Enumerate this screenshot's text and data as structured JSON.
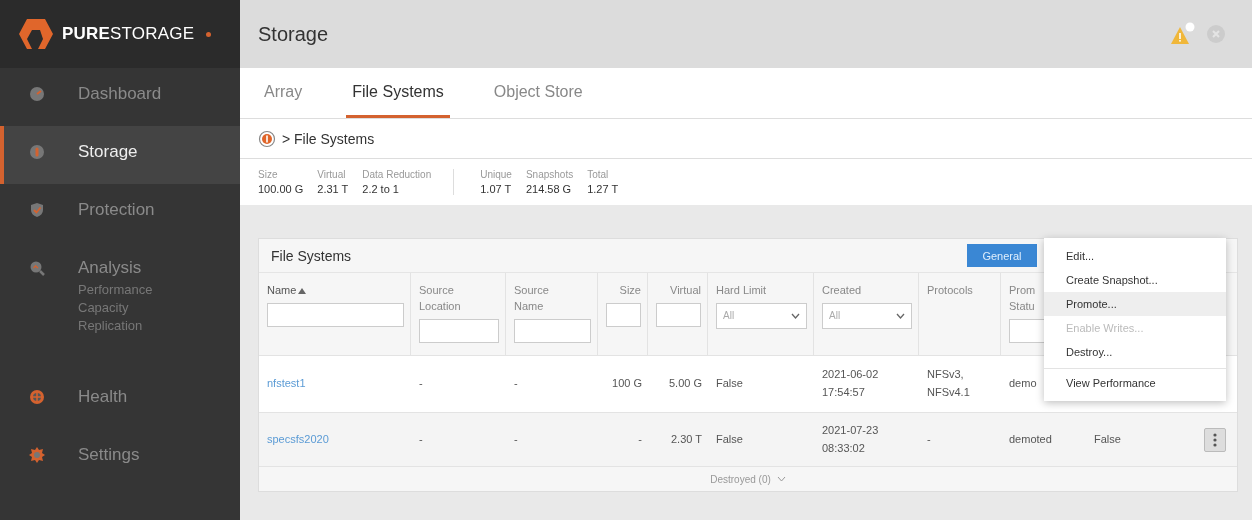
{
  "sidebar": {
    "logo": "**PURE**STORAGE",
    "items": [
      {
        "label": "Dashboard",
        "selected": false
      },
      {
        "label": "Storage",
        "selected": true
      },
      {
        "label": "Protection",
        "selected": false
      },
      {
        "label": "Analysis",
        "selected": false,
        "children": [
          {
            "label": "Performance"
          },
          {
            "label": "Capacity"
          },
          {
            "label": "Replication"
          }
        ]
      },
      {
        "label": "Health",
        "selected": false
      },
      {
        "label": "Settings",
        "selected": false
      }
    ]
  },
  "header": {
    "title": "Storage"
  },
  "tabs": [
    {
      "label": "Array",
      "selected": false
    },
    {
      "label": "File Systems",
      "selected": true
    },
    {
      "label": "Object Store",
      "selected": false
    }
  ],
  "breadcrumb": "> File Systems",
  "stats": [
    [
      {
        "label": "Size",
        "value": "100.00 G"
      },
      {
        "label": "Virtual",
        "value": "2.31 T"
      },
      {
        "label": "Data Reduction",
        "value": "2.2 to 1"
      }
    ],
    [
      {
        "label": "Unique",
        "value": "1.07 T"
      },
      {
        "label": "Snapshots",
        "value": "214.58 G"
      },
      {
        "label": "Total",
        "value": "1.27 T"
      }
    ]
  ],
  "table": {
    "title": "File Systems",
    "view_button": "General",
    "columns": [
      {
        "label": "Name",
        "kind": "text",
        "sorted": true
      },
      {
        "label": "Source Location",
        "kind": "text",
        "sorted": false
      },
      {
        "label": "Source Name",
        "kind": "text",
        "sorted": false
      },
      {
        "label": "Size",
        "kind": "text",
        "sorted": false
      },
      {
        "label": "Virtual",
        "kind": "text",
        "sorted": false
      },
      {
        "label": "Hard Limit",
        "kind": "select",
        "value": "All",
        "sorted": false
      },
      {
        "label": "Created",
        "kind": "select",
        "value": "All",
        "sorted": false
      },
      {
        "label": "Protocols",
        "kind": "plain",
        "sorted": false
      },
      {
        "label": "Prom Statu",
        "kind": "text",
        "sorted": false
      }
    ],
    "rows": [
      {
        "cells": [
          "nfstest1",
          "-",
          "-",
          "100 G",
          "5.00 G",
          "False",
          "2021-06-02 17:54:57",
          "NFSv3, NFSv4.1",
          "demo"
        ]
      },
      {
        "cells": [
          "specsfs2020",
          "-",
          "-",
          "-",
          "2.30 T",
          "False",
          "2021-07-23 08:33:02",
          "-",
          "demoted",
          "False"
        ]
      }
    ],
    "footer": "Destroyed (0)"
  },
  "menu": [
    {
      "label": "Edit...",
      "disabled": false,
      "highlighted": false,
      "divider_before": false
    },
    {
      "label": "Create Snapshot...",
      "disabled": false,
      "highlighted": false,
      "divider_before": false
    },
    {
      "label": "Promote...",
      "disabled": false,
      "highlighted": true,
      "divider_before": false
    },
    {
      "label": "Enable Writes...",
      "disabled": true,
      "highlighted": false,
      "divider_before": false
    },
    {
      "label": "Destroy...",
      "disabled": false,
      "highlighted": false,
      "divider_before": false
    },
    {
      "label": "View Performance",
      "disabled": false,
      "highlighted": false,
      "divider_before": true
    }
  ]
}
